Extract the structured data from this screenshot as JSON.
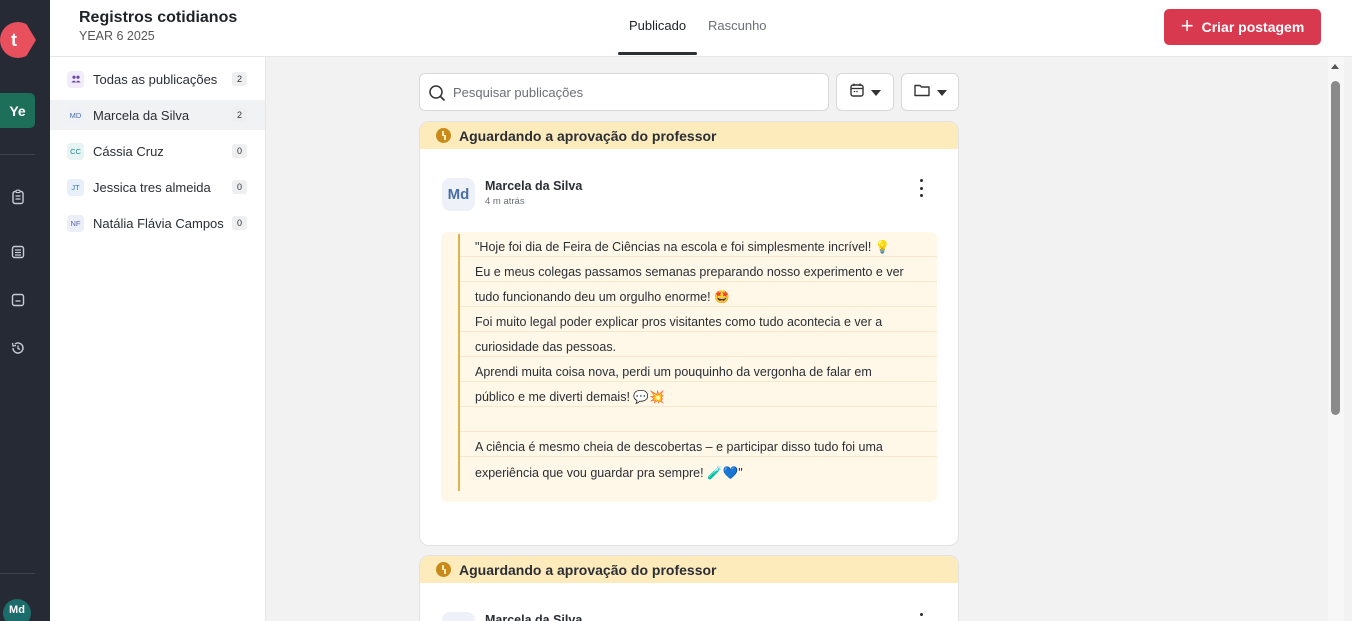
{
  "rail": {
    "logo_letter": "t",
    "class_badge": "Ye",
    "user_initials": "Md",
    "icons": [
      "clipboard-icon",
      "list-icon",
      "board-icon",
      "history-icon"
    ]
  },
  "header": {
    "title": "Registros cotidianos",
    "subtitle": "YEAR 6 2025",
    "tabs": [
      {
        "label": "Publicado",
        "active": true
      },
      {
        "label": "Rascunho",
        "active": false
      }
    ],
    "create_label": "Criar postagem",
    "create_color": "#d8394f"
  },
  "students": [
    {
      "initials": "",
      "name": "Todas as publicações",
      "count": "2",
      "color": "#7b4fb6",
      "bg": "#f1ecf8"
    },
    {
      "initials": "MD",
      "name": "Marcela da Silva",
      "count": "2",
      "color": "#4a6fa8",
      "bg": "#eef1f7"
    },
    {
      "initials": "CC",
      "name": "Cássia Cruz",
      "count": "0",
      "color": "#1d8a8a",
      "bg": "#e6f4f4"
    },
    {
      "initials": "JT",
      "name": "Jessica tres almeida",
      "count": "0",
      "color": "#3a7bb8",
      "bg": "#e7f0f8"
    },
    {
      "initials": "NF",
      "name": "Natália Flávia Campos",
      "count": "0",
      "color": "#5a6bb0",
      "bg": "#eceef8"
    }
  ],
  "search": {
    "placeholder": "Pesquisar publicações"
  },
  "posts": [
    {
      "status": "Aguardando a aprovação do professor",
      "author_initials": "Md",
      "author": "Marcela da Silva",
      "time": "4 m atrás",
      "lines": [
        "\"Hoje foi dia de Feira de Ciências na escola e foi simplesmente incrível! 💡",
        "Eu e meus colegas passamos semanas preparando nosso experimento e ver",
        "tudo funcionando deu um orgulho enorme! 🤩",
        "Foi muito legal poder explicar pros visitantes como tudo acontecia e ver a",
        "curiosidade das pessoas.",
        "Aprendi muita coisa nova, perdi um pouquinho da vergonha de falar em",
        "público e me diverti demais! 💬💥",
        "",
        "A ciência é mesmo cheia de descobertas – e participar disso tudo foi uma",
        "experiência que vou guardar pra sempre! 🧪💙\""
      ]
    },
    {
      "status": "Aguardando a aprovação do professor",
      "author_initials": "",
      "author": "Marcela da Silva",
      "time": "",
      "lines": []
    }
  ]
}
